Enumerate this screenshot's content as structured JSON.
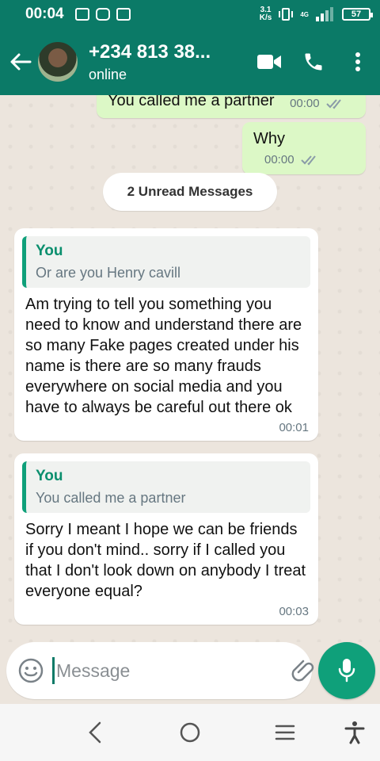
{
  "status_bar": {
    "time": "00:04",
    "net_speed_value": "3.1",
    "net_speed_unit": "K/s",
    "network_type": "4G",
    "battery": "57"
  },
  "header": {
    "contact_name": "+234 813 38...",
    "contact_status": "online",
    "icons": [
      "back-arrow-icon",
      "video-call-icon",
      "voice-call-icon",
      "more-options-icon"
    ]
  },
  "messages_out": [
    {
      "text": "You called me a partner",
      "time": "00:00"
    },
    {
      "text": "Why",
      "time": "00:00"
    }
  ],
  "unread_label": "2 Unread Messages",
  "messages_in": [
    {
      "quote_author": "You",
      "quote_text": "Or are you Henry cavill",
      "text": "Am trying to tell you something you need to know and understand there are so many Fake pages created under his name is there are so many frauds everywhere on social media and you have to always be careful out there ok",
      "time": "00:01"
    },
    {
      "quote_author": "You",
      "quote_text": "You called me a partner",
      "text": "Sorry I meant I hope we can be friends if you don't mind.. sorry if I called you that I don't look down on anybody I treat everyone equal?",
      "time": "00:03"
    }
  ],
  "composer": {
    "placeholder": "Message",
    "icons": [
      "emoji-icon",
      "attach-icon",
      "camera-icon",
      "mic-icon"
    ]
  },
  "colors": {
    "header": "#0b7a67",
    "accent": "#0fa07a",
    "outgoing_bubble": "#dcf8c6",
    "incoming_bubble": "#ffffff"
  }
}
